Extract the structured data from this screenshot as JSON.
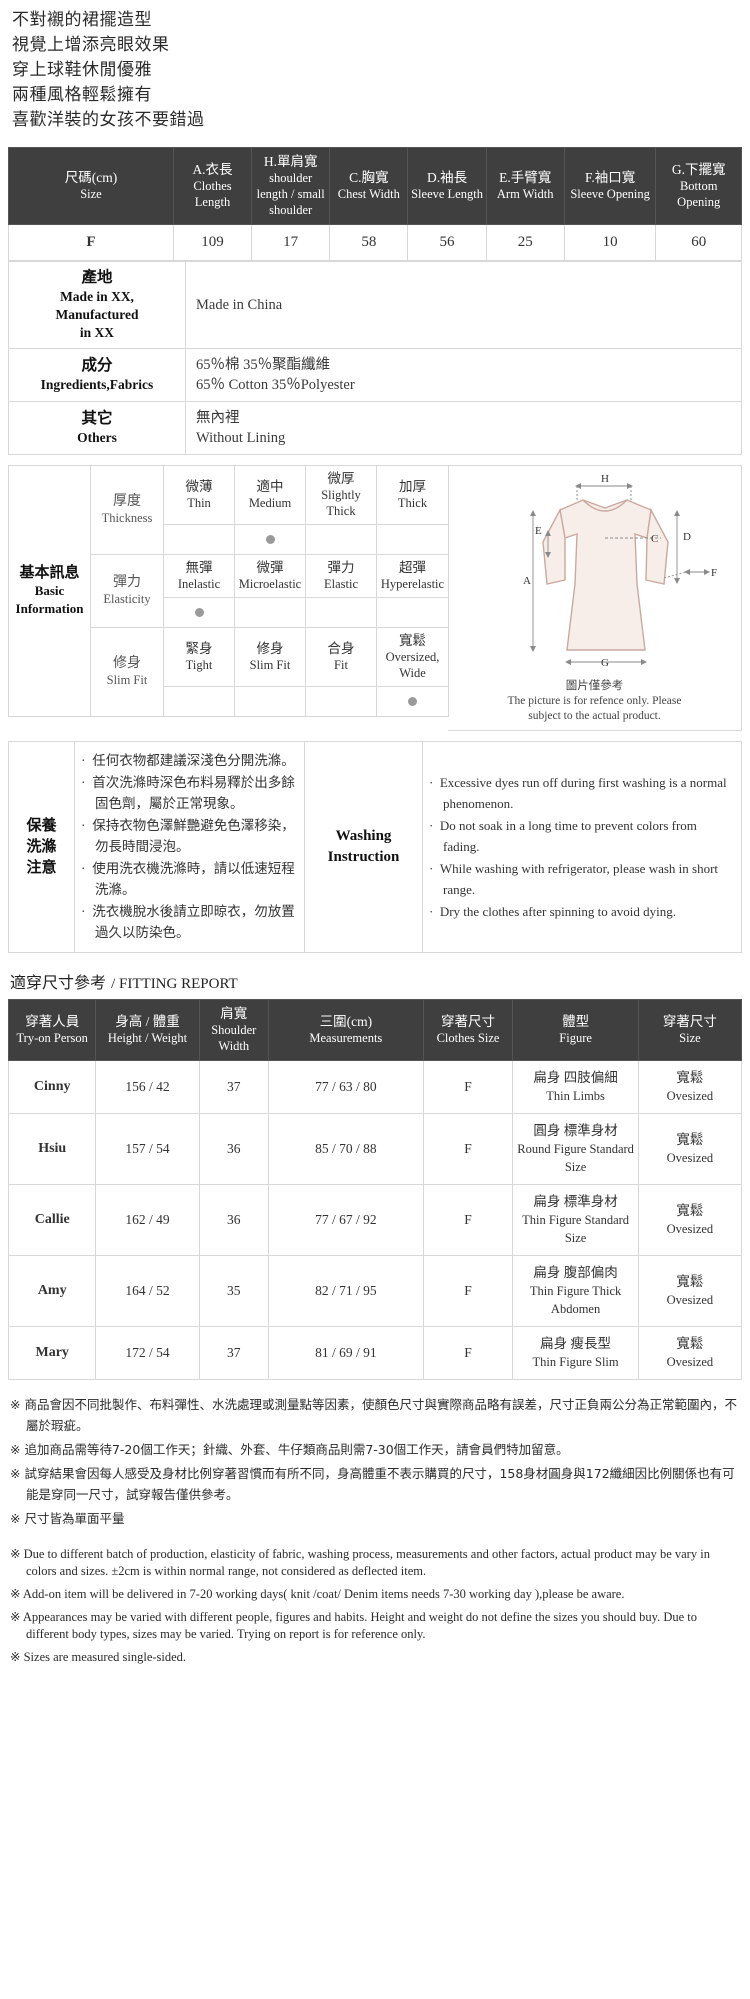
{
  "intro": {
    "lines": [
      "不對襯的裙擺造型",
      "視覺上增添亮眼效果",
      "穿上球鞋休閒優雅",
      "兩種風格輕鬆擁有",
      "喜歡洋裝的女孩不要錯過"
    ]
  },
  "size_table": {
    "headers": [
      {
        "cn": "尺碼(cm)",
        "en": "Size"
      },
      {
        "cn": "A.衣長",
        "en": "Clothes Length"
      },
      {
        "cn": "H.單肩寬",
        "en": "shoulder length / small shoulder"
      },
      {
        "cn": "C.胸寬",
        "en": "Chest Width"
      },
      {
        "cn": "D.袖長",
        "en": "Sleeve Length"
      },
      {
        "cn": "E.手臂寬",
        "en": "Arm Width"
      },
      {
        "cn": "F.袖口寬",
        "en": "Sleeve Opening"
      },
      {
        "cn": "G.下擺寬",
        "en": "Bottom Opening"
      }
    ],
    "rows": [
      {
        "size": "F",
        "values": [
          "109",
          "17",
          "58",
          "56",
          "25",
          "10",
          "60"
        ]
      }
    ]
  },
  "info_rows": [
    {
      "label_cn": "產地",
      "label_en_1": "Made in XX,",
      "label_en_2": "Manufactured",
      "label_en_3": "in XX",
      "value_cn": "Made in China",
      "value_en": ""
    },
    {
      "label_cn": "成分",
      "label_en_1": "Ingredients,Fabrics",
      "value_cn": "65％棉 35％聚酯纖維",
      "value_en": "65％ Cotton 35％Polyester"
    },
    {
      "label_cn": "其它",
      "label_en_1": "Others",
      "value_cn": "無內裡",
      "value_en": "Without Lining"
    }
  ],
  "basic_info": {
    "label_cn": "基本訊息",
    "label_en_1": "Basic",
    "label_en_2": "Information",
    "attributes": [
      {
        "name_cn": "厚度",
        "name_en": "Thickness",
        "options": [
          {
            "cn": "微薄",
            "en": "Thin"
          },
          {
            "cn": "適中",
            "en": "Medium"
          },
          {
            "cn": "微厚",
            "en": "Slightly Thick"
          },
          {
            "cn": "加厚",
            "en": "Thick"
          }
        ],
        "selected_index": 1
      },
      {
        "name_cn": "彈力",
        "name_en": "Elasticity",
        "options": [
          {
            "cn": "無彈",
            "en": "Inelastic"
          },
          {
            "cn": "微彈",
            "en": "Microelastic"
          },
          {
            "cn": "彈力",
            "en": "Elastic"
          },
          {
            "cn": "超彈",
            "en": "Hyperelastic"
          }
        ],
        "selected_index": 0
      },
      {
        "name_cn": "修身",
        "name_en": "Slim Fit",
        "options": [
          {
            "cn": "緊身",
            "en": "Tight"
          },
          {
            "cn": "修身",
            "en": "Slim Fit"
          },
          {
            "cn": "合身",
            "en": "Fit"
          },
          {
            "cn": "寬鬆",
            "en": "Oversized, Wide"
          }
        ],
        "selected_index": 3
      }
    ],
    "diagram": {
      "labels": [
        "A",
        "C",
        "D",
        "E",
        "F",
        "G",
        "H"
      ],
      "note_cn": "圖片僅參考",
      "note_en_1": "The picture is for refence only. Please",
      "note_en_2": "subject to the actual product."
    }
  },
  "washing": {
    "label_cn_1": "保養",
    "label_cn_2": "洗滌",
    "label_cn_3": "注意",
    "label_en_1": "Washing",
    "label_en_2": "Instruction",
    "items_cn": [
      "任何衣物都建議深淺色分開洗滌。",
      "首次洗滌時深色布料易釋於出多餘固色劑，屬於正常現象。",
      "保持衣物色澤鮮艷避免色澤移染，勿長時間浸泡。",
      "使用洗衣機洗滌時，請以低速短程洗滌。",
      "洗衣機脫水後請立即晾衣，勿放置過久以防染色。"
    ],
    "items_en": [
      "Excessive dyes run off during first washing is a normal phenomenon.",
      "Do not soak in a long time to prevent colors from fading.",
      "While washing with refrigerator, please wash in short range.",
      "Dry the clothes after spinning to avoid dying."
    ]
  },
  "fitting_report": {
    "title_cn": "適穿尺寸參考",
    "title_en": "/ FITTING REPORT",
    "headers": [
      {
        "cn": "穿著人員",
        "en": "Try-on Person"
      },
      {
        "cn": "身高 / 體重",
        "en": "Height / Weight"
      },
      {
        "cn": "肩寬",
        "en": "Shoulder Width"
      },
      {
        "cn": "三圍(cm)",
        "en": "Measurements"
      },
      {
        "cn": "穿著尺寸",
        "en": "Clothes Size"
      },
      {
        "cn": "體型",
        "en": "Figure"
      },
      {
        "cn": "穿著尺寸",
        "en": "Size"
      }
    ],
    "rows": [
      {
        "person": "Cinny",
        "height_weight": "156 / 42",
        "shoulder": "37",
        "measurements": "77 / 63 / 80",
        "clothes_size": "F",
        "figure_cn": "扁身 四肢偏細",
        "figure_en": "Thin Limbs",
        "size_cn": "寬鬆",
        "size_en": "Ovesized"
      },
      {
        "person": "Hsiu",
        "height_weight": "157 / 54",
        "shoulder": "36",
        "measurements": "85 / 70 / 88",
        "clothes_size": "F",
        "figure_cn": "圓身 標準身材",
        "figure_en": "Round Figure Standard Size",
        "size_cn": "寬鬆",
        "size_en": "Ovesized"
      },
      {
        "person": "Callie",
        "height_weight": "162 / 49",
        "shoulder": "36",
        "measurements": "77 / 67 / 92",
        "clothes_size": "F",
        "figure_cn": "扁身 標準身材",
        "figure_en": "Thin Figure Standard Size",
        "size_cn": "寬鬆",
        "size_en": "Ovesized"
      },
      {
        "person": "Amy",
        "height_weight": "164 / 52",
        "shoulder": "35",
        "measurements": "82 / 71 / 95",
        "clothes_size": "F",
        "figure_cn": "扁身 腹部偏肉",
        "figure_en": "Thin Figure Thick Abdomen",
        "size_cn": "寬鬆",
        "size_en": "Ovesized"
      },
      {
        "person": "Mary",
        "height_weight": "172 / 54",
        "shoulder": "37",
        "measurements": "81 / 69 / 91",
        "clothes_size": "F",
        "figure_cn": "扁身 瘦長型",
        "figure_en": "Thin Figure Slim",
        "size_cn": "寬鬆",
        "size_en": "Ovesized"
      }
    ]
  },
  "notices": {
    "cn": [
      "※ 商品會因不同批製作、布料彈性、水洗處理或測量點等因素，使顏色尺寸與實際商品略有誤差，尺寸正負兩公分為正常範圍內，不屬於瑕疵。",
      "※ 追加商品需等待7-20個工作天；針織、外套、牛仔類商品則需7-30個工作天，請會員們特加留意。",
      "※ 試穿結果會因每人感受及身材比例穿著習慣而有所不同，身高體重不表示購買的尺寸，158身材圓身與172纖細因比例關係也有可能是穿同一尺寸，試穿報告僅供參考。",
      "※ 尺寸皆為單面平量"
    ],
    "en": [
      "※ Due to different batch of production, elasticity of fabric, washing process, measurements and other factors, actual product may be vary in colors and sizes. ±2cm is within normal range, not considered as deflected item.",
      "※ Add-on item will be delivered in 7-20 working days( knit /coat/ Denim items needs 7-30 working day ),please be aware.",
      "※ Appearances may be varied with different people, figures and habits. Height and weight do not define the sizes you should buy. Due to different body types, sizes may be varied. Trying on report is for reference only.",
      "※ Sizes are measured single-sided."
    ]
  }
}
